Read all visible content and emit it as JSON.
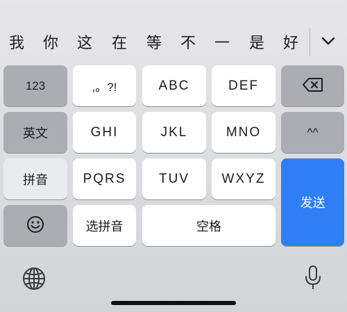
{
  "candidates": [
    "我",
    "你",
    "这",
    "在",
    "等",
    "不",
    "一",
    "是",
    "好"
  ],
  "keys": {
    "num": "123",
    "punct": ",。?!",
    "abc": "ABC",
    "def": "DEF",
    "english": "英文",
    "ghi": "GHI",
    "jkl": "JKL",
    "mno": "MNO",
    "emoticon": "^^",
    "pinyin": "拼音",
    "pqrs": "PQRS",
    "tuv": "TUV",
    "wxyz": "WXYZ",
    "send": "发送",
    "select_pinyin": "选拼音",
    "space": "空格"
  },
  "icons": {
    "expand": "chevron-down-icon",
    "delete": "backspace-icon",
    "emoji": "smiley-icon",
    "globe": "globe-icon",
    "mic": "microphone-icon"
  },
  "colors": {
    "send_key": "#2f7ef6",
    "function_key": "#abadb3",
    "letter_key": "#ffffff"
  }
}
